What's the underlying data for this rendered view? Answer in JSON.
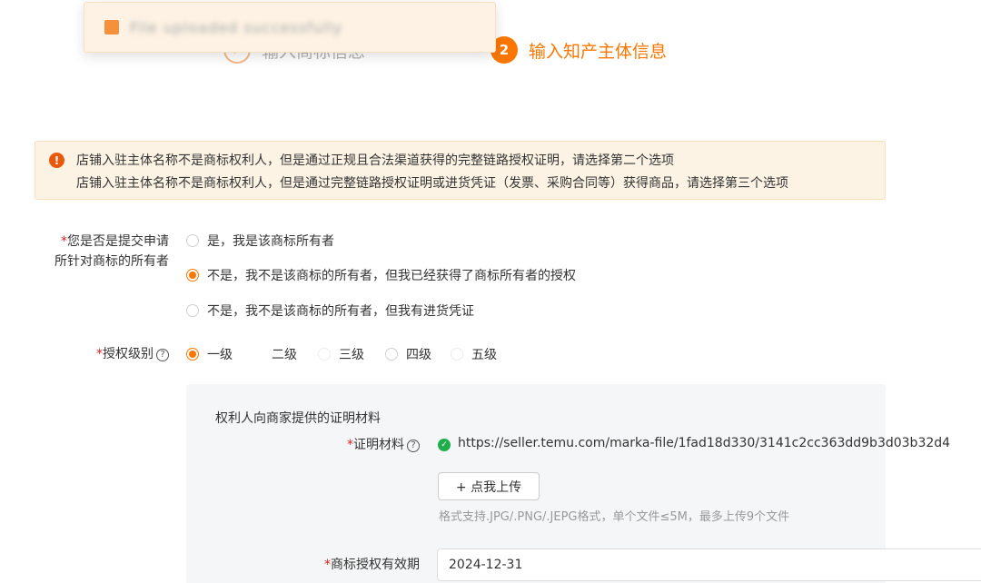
{
  "steps": [
    {
      "number": "✓",
      "label": "输入商标信息"
    },
    {
      "number": "2",
      "label": "输入知产主体信息"
    }
  ],
  "toast": {
    "text": "File uploaded successfully"
  },
  "alert": {
    "line1": "店铺入驻主体名称不是商标权利人，但是通过正规且合法渠道获得的完整链路授权证明，请选择第二个选项",
    "line2": "店铺入驻主体名称不是商标权利人，但是通过完整链路授权证明或进货凭证（发票、采购合同等）获得商品，请选择第三个选项"
  },
  "owner_question": {
    "required_mark": "*",
    "line1": "您是否是提交申请",
    "line2": "所针对商标的所有者",
    "options": [
      {
        "label": "是，我是该商标所有者",
        "checked": false
      },
      {
        "label": "不是，我不是该商标的所有者，但我已经获得了商标所有者的授权",
        "checked": true
      },
      {
        "label": "不是，我不是该商标的所有者，但我有进货凭证",
        "checked": false
      }
    ]
  },
  "auth_level": {
    "required_mark": "*",
    "label": "授权级别",
    "help_icon": "?",
    "options": [
      {
        "label": "一级",
        "checked": true
      },
      {
        "label": "二级",
        "checked": false
      },
      {
        "label": "三级",
        "checked": false
      },
      {
        "label": "四级",
        "checked": false
      },
      {
        "label": "五级",
        "checked": false
      }
    ]
  },
  "proof_panel": {
    "title": "权利人向商家提供的证明材料",
    "proof_label": "证明材料",
    "required_mark": "*",
    "help_icon": "?",
    "file_url": "https://seller.temu.com/marka-file/1fad18d330/3141c2cc363dd9b3d03b32d4",
    "upload_button": "+ 点我上传",
    "hint": "格式支持.JPG/.PNG/.JEPG格式，单个文件≤5M，最多上传9个文件",
    "validity_label": "商标授权有效期",
    "validity_value": "2024-12-31"
  },
  "colors": {
    "accent": "#fb7701",
    "alert_bg": "#fdf3e4",
    "success": "#1fad4b"
  }
}
